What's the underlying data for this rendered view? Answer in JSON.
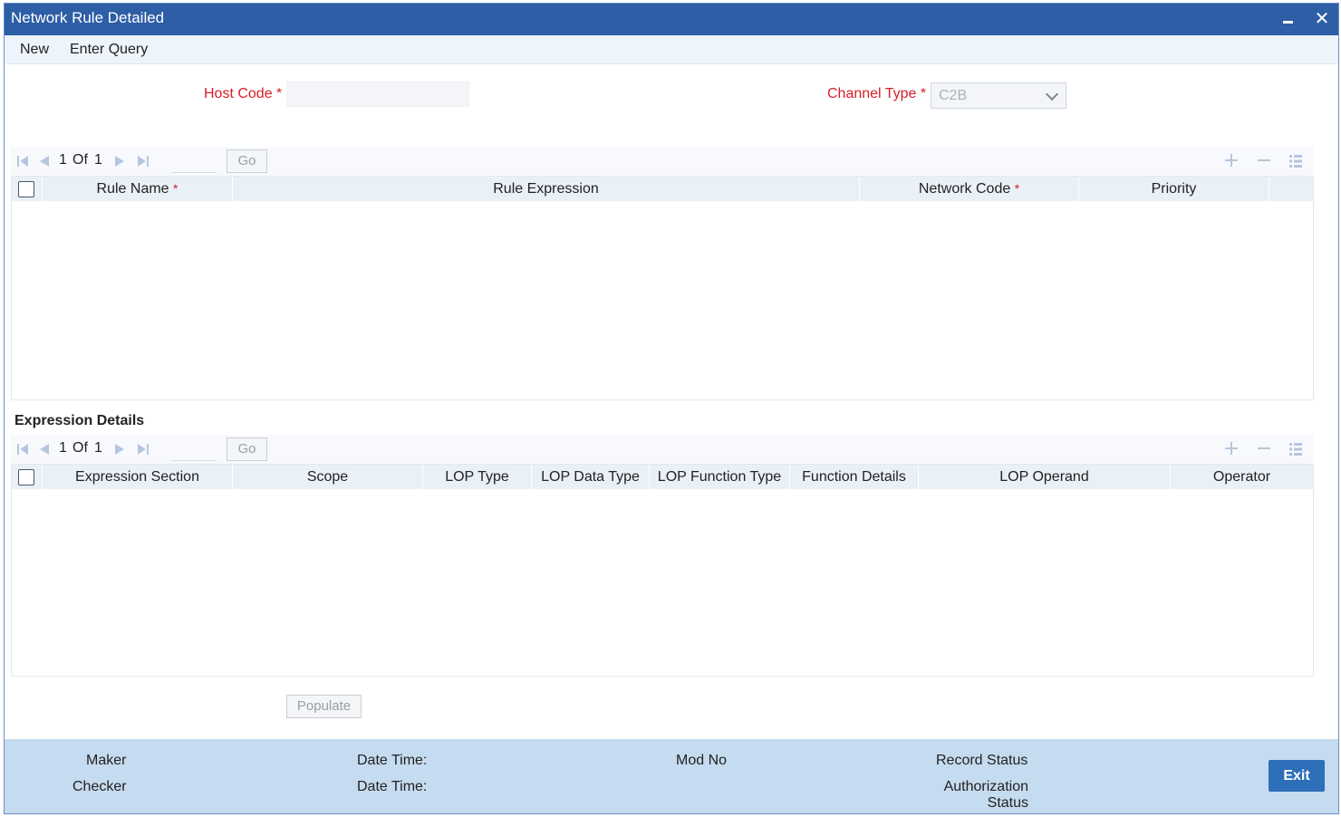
{
  "window": {
    "title": "Network Rule Detailed"
  },
  "menu": {
    "new": "New",
    "enter_query": "Enter Query"
  },
  "form": {
    "host_code_label": "Host Code",
    "required_mark": "*",
    "host_code_value": "",
    "channel_type_label": "Channel Type",
    "channel_type_value": "C2B"
  },
  "rules_grid": {
    "pager": {
      "current": "1",
      "of": "Of",
      "total": "1",
      "go": "Go"
    },
    "columns": [
      "Rule Name",
      "Rule Expression",
      "Network Code",
      "Priority"
    ],
    "rows": []
  },
  "expression_details": {
    "title": "Expression Details",
    "pager": {
      "current": "1",
      "of": "Of",
      "total": "1",
      "go": "Go"
    },
    "columns": [
      "Expression Section",
      "Scope",
      "LOP Type",
      "LOP Data Type",
      "LOP Function Type",
      "Function Details",
      "LOP Operand",
      "Operator"
    ],
    "rows": []
  },
  "populate_label": "Populate",
  "footer": {
    "maker": "Maker",
    "checker": "Checker",
    "date_time_1": "Date Time:",
    "date_time_2": "Date Time:",
    "mod_no": "Mod No",
    "record_status": "Record Status",
    "authorization_status": "Authorization Status",
    "exit": "Exit"
  },
  "colors": {
    "title_bar": "#2d5ea6",
    "required_red": "#d4202a",
    "footer_bg": "#c5dbef",
    "exit_button": "#2d6fb8"
  }
}
